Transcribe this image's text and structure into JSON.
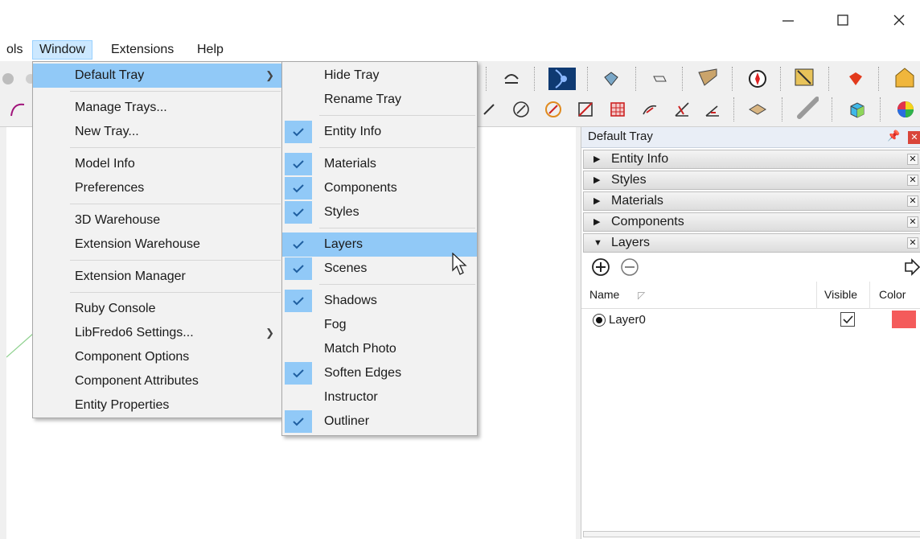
{
  "menubar": {
    "items": [
      {
        "label": "ols"
      },
      {
        "label": "Window"
      },
      {
        "label": "Extensions"
      },
      {
        "label": "Help"
      }
    ]
  },
  "window_menu": {
    "groups": [
      [
        {
          "label": "Default Tray",
          "submenu": true
        }
      ],
      [
        {
          "label": "Manage Trays..."
        },
        {
          "label": "New Tray..."
        }
      ],
      [
        {
          "label": "Model Info"
        },
        {
          "label": "Preferences"
        }
      ],
      [
        {
          "label": "3D Warehouse"
        },
        {
          "label": "Extension Warehouse"
        }
      ],
      [
        {
          "label": "Extension Manager"
        }
      ],
      [
        {
          "label": "Ruby Console"
        },
        {
          "label": "LibFredo6 Settings...",
          "submenu": true
        },
        {
          "label": "Component Options"
        },
        {
          "label": "Component Attributes"
        },
        {
          "label": "Entity Properties"
        }
      ]
    ]
  },
  "tray_submenu": {
    "items": [
      {
        "label": "Hide Tray",
        "checked": false
      },
      {
        "label": "Rename Tray",
        "checked": false
      },
      {
        "label": "Entity Info",
        "checked": true
      },
      {
        "label": "Materials",
        "checked": true
      },
      {
        "label": "Components",
        "checked": true
      },
      {
        "label": "Styles",
        "checked": true
      },
      {
        "label": "Layers",
        "checked": true
      },
      {
        "label": "Scenes",
        "checked": true
      },
      {
        "label": "Shadows",
        "checked": true
      },
      {
        "label": "Fog",
        "checked": false
      },
      {
        "label": "Match Photo",
        "checked": false
      },
      {
        "label": "Soften Edges",
        "checked": true
      },
      {
        "label": "Instructor",
        "checked": false
      },
      {
        "label": "Outliner",
        "checked": true
      }
    ]
  },
  "tray": {
    "title": "Default Tray",
    "panels": [
      {
        "label": "Entity Info",
        "expanded": false
      },
      {
        "label": "Styles",
        "expanded": false
      },
      {
        "label": "Materials",
        "expanded": false
      },
      {
        "label": "Components",
        "expanded": false
      },
      {
        "label": "Layers",
        "expanded": true
      }
    ],
    "layers": {
      "columns": {
        "name": "Name",
        "visible": "Visible",
        "color": "Color"
      },
      "rows": [
        {
          "name": "Layer0",
          "visible": true,
          "color": "#f45b5b"
        }
      ]
    }
  },
  "colors": {
    "highlight": "#91c9f7",
    "accent_active_menu": "#cce8ff",
    "layer_color": "#f45b5b"
  }
}
